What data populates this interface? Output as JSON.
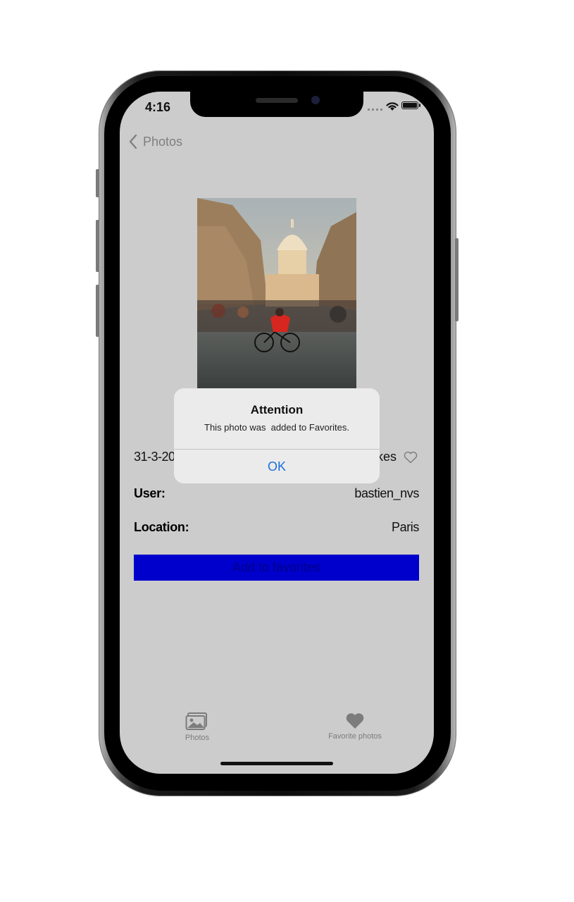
{
  "status_bar": {
    "time": "4:16"
  },
  "nav": {
    "back_label": "Photos"
  },
  "photo_detail": {
    "date": "31-3-20",
    "likes_label": "kes",
    "user_label": "User:",
    "user_value": "bastien_nvs",
    "location_label": "Location:",
    "location_value": "Paris",
    "add_button_label": "Add to favorites"
  },
  "alert": {
    "title": "Attention",
    "message": "This photo was  added to Favorites.",
    "ok_label": "OK"
  },
  "tab_bar": {
    "items": [
      {
        "label": "Photos",
        "icon": "photos-icon"
      },
      {
        "label": "Favorite photos",
        "icon": "heart-icon"
      }
    ]
  },
  "colors": {
    "screen_background": "#cccccc",
    "button_fill": "#0000cc",
    "link_blue": "#1a6fd9",
    "tab_gray": "#7c7c7c"
  }
}
